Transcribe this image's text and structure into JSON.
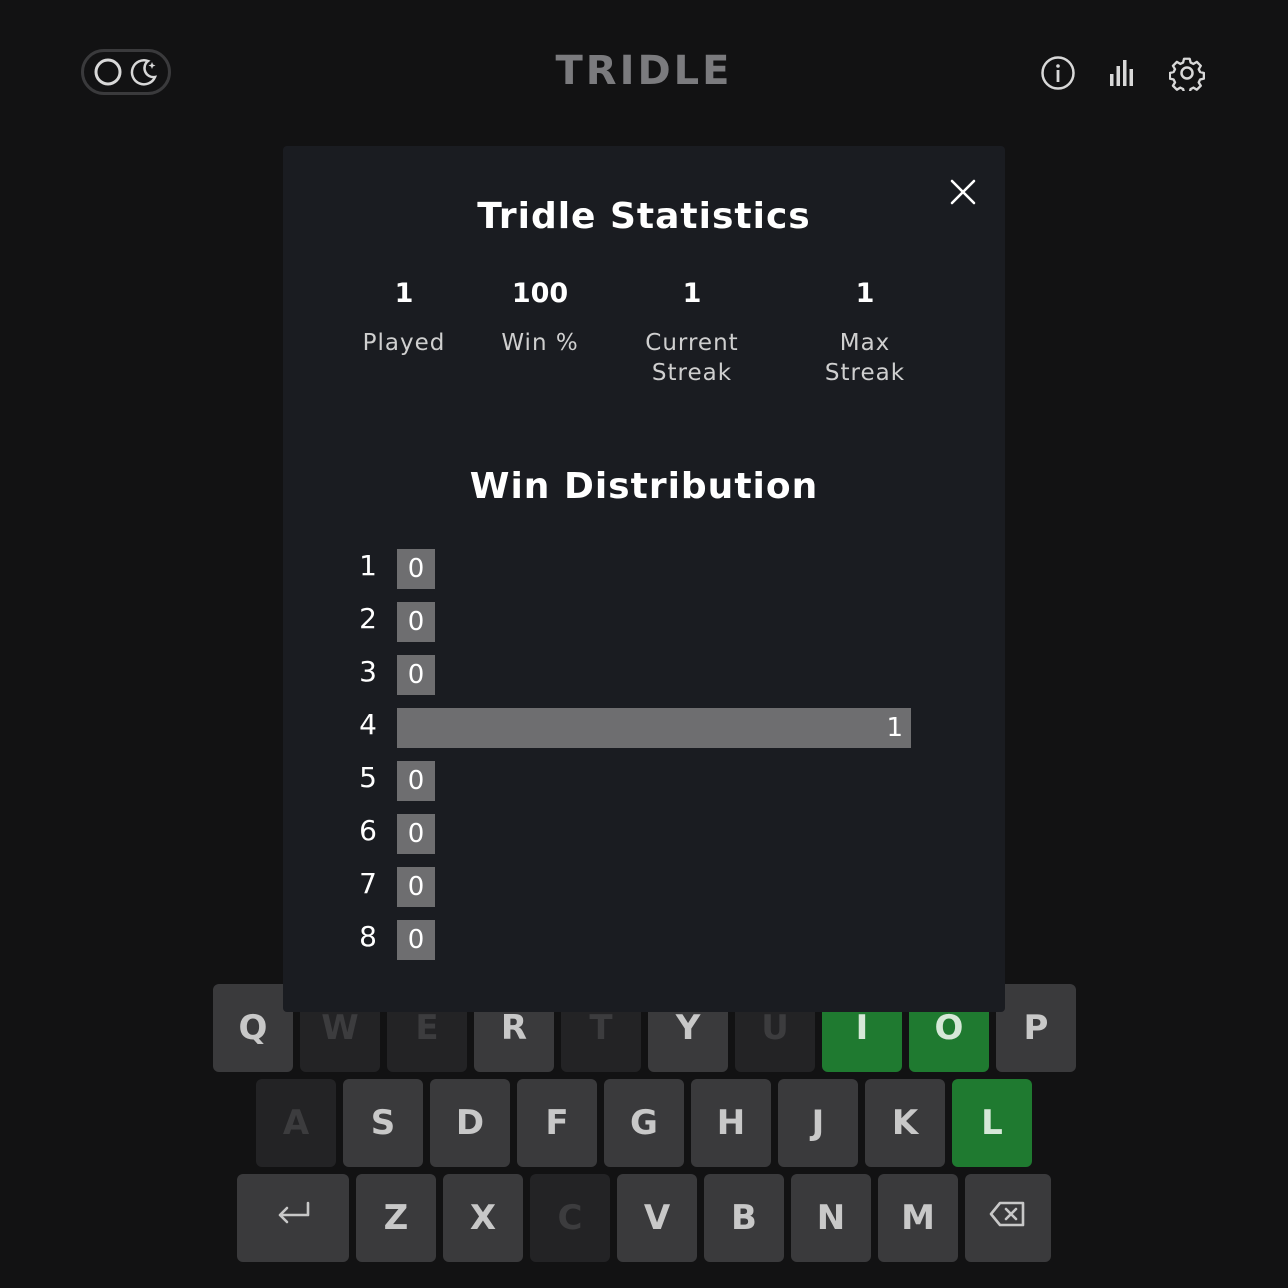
{
  "header": {
    "title": "TRIDLE",
    "icons": [
      "sun-icon",
      "moon-icon",
      "info-icon",
      "stats-icon",
      "settings-icon"
    ]
  },
  "modal": {
    "title": "Tridle Statistics",
    "stats": [
      {
        "value": "1",
        "label": "Played"
      },
      {
        "value": "100",
        "label": "Win %"
      },
      {
        "value": "1",
        "label": "Current\nStreak"
      },
      {
        "value": "1",
        "label": "Max\nStreak"
      }
    ],
    "distribution_title": "Win Distribution",
    "distribution": [
      {
        "guess": "1",
        "count": 0
      },
      {
        "guess": "2",
        "count": 0
      },
      {
        "guess": "3",
        "count": 0
      },
      {
        "guess": "4",
        "count": 1
      },
      {
        "guess": "5",
        "count": 0
      },
      {
        "guess": "6",
        "count": 0
      },
      {
        "guess": "7",
        "count": 0
      },
      {
        "guess": "8",
        "count": 0
      }
    ]
  },
  "keyboard": {
    "row1": [
      {
        "key": "Q",
        "state": "unused"
      },
      {
        "key": "W",
        "state": "absent"
      },
      {
        "key": "E",
        "state": "absent"
      },
      {
        "key": "R",
        "state": "unused"
      },
      {
        "key": "T",
        "state": "absent"
      },
      {
        "key": "Y",
        "state": "unused"
      },
      {
        "key": "U",
        "state": "absent"
      },
      {
        "key": "I",
        "state": "correct"
      },
      {
        "key": "O",
        "state": "correct"
      },
      {
        "key": "P",
        "state": "unused"
      }
    ],
    "row2": [
      {
        "key": "A",
        "state": "absent"
      },
      {
        "key": "S",
        "state": "unused"
      },
      {
        "key": "D",
        "state": "unused"
      },
      {
        "key": "F",
        "state": "unused"
      },
      {
        "key": "G",
        "state": "unused"
      },
      {
        "key": "H",
        "state": "unused"
      },
      {
        "key": "J",
        "state": "unused"
      },
      {
        "key": "K",
        "state": "unused"
      },
      {
        "key": "L",
        "state": "correct"
      }
    ],
    "row3": [
      {
        "key": "ENTER",
        "state": "unused",
        "icon": "enter-icon"
      },
      {
        "key": "Z",
        "state": "unused"
      },
      {
        "key": "X",
        "state": "unused"
      },
      {
        "key": "C",
        "state": "absent"
      },
      {
        "key": "V",
        "state": "unused"
      },
      {
        "key": "B",
        "state": "unused"
      },
      {
        "key": "N",
        "state": "unused"
      },
      {
        "key": "M",
        "state": "unused"
      },
      {
        "key": "BACKSPACE",
        "state": "unused",
        "icon": "backspace-icon"
      }
    ]
  },
  "colors": {
    "background": "#121213",
    "modal": "#1a1c21",
    "key": "#3a3a3c",
    "key_absent": "#232325",
    "key_correct": "#1f7a30",
    "bar": "#6e6e70"
  }
}
